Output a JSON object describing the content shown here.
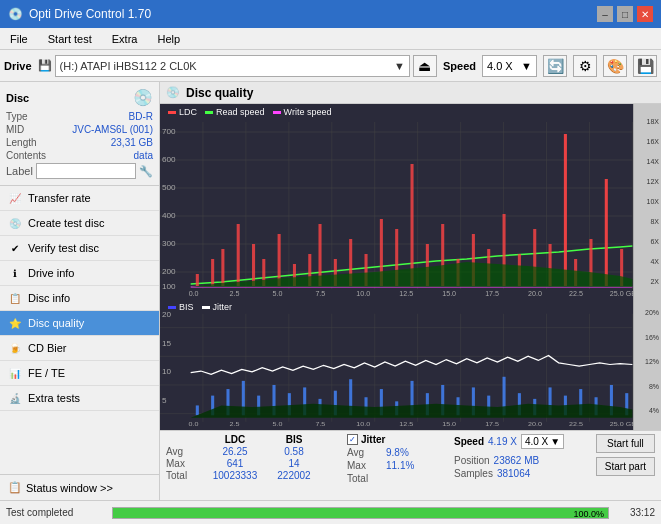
{
  "app": {
    "title": "Opti Drive Control 1.70",
    "icon": "💿"
  },
  "titlebar": {
    "title": "Opti Drive Control 1.70",
    "minimize_label": "–",
    "maximize_label": "□",
    "close_label": "✕"
  },
  "menubar": {
    "items": [
      "File",
      "Start test",
      "Extra",
      "Help"
    ]
  },
  "drivebar": {
    "label": "Drive",
    "drive_value": "(H:) ATAPI iHBS112 2 CL0K",
    "speed_label": "Speed",
    "speed_value": "4.0 X"
  },
  "disc": {
    "title": "Disc",
    "type_label": "Type",
    "type_value": "BD-R",
    "mid_label": "MID",
    "mid_value": "JVC-AMS6L (001)",
    "length_label": "Length",
    "length_value": "23,31 GB",
    "contents_label": "Contents",
    "contents_value": "data",
    "label_label": "Label",
    "label_placeholder": ""
  },
  "nav": {
    "items": [
      {
        "id": "transfer-rate",
        "label": "Transfer rate",
        "icon": "📈"
      },
      {
        "id": "create-test-disc",
        "label": "Create test disc",
        "icon": "💿"
      },
      {
        "id": "verify-test-disc",
        "label": "Verify test disc",
        "icon": "✔"
      },
      {
        "id": "drive-info",
        "label": "Drive info",
        "icon": "ℹ"
      },
      {
        "id": "disc-info",
        "label": "Disc info",
        "icon": "📋"
      },
      {
        "id": "disc-quality",
        "label": "Disc quality",
        "icon": "⭐",
        "active": true
      },
      {
        "id": "cd-bier",
        "label": "CD Bier",
        "icon": "🍺"
      },
      {
        "id": "fe-te",
        "label": "FE / TE",
        "icon": "📊"
      },
      {
        "id": "extra-tests",
        "label": "Extra tests",
        "icon": "🔬"
      }
    ]
  },
  "status_window": {
    "label": "Status window >> "
  },
  "content": {
    "title": "Disc quality",
    "icon": "💿",
    "chart_top": {
      "legend": [
        {
          "label": "LDC",
          "color": "#ff4444"
        },
        {
          "label": "Read speed",
          "color": "#44ff44"
        },
        {
          "label": "Write speed",
          "color": "#ff44ff"
        }
      ],
      "y_axis_labels": [
        "700",
        "600",
        "500",
        "400",
        "300",
        "200",
        "100"
      ],
      "y_axis_right_labels": [
        "18X",
        "16X",
        "14X",
        "12X",
        "10X",
        "8X",
        "6X",
        "4X",
        "2X"
      ],
      "x_axis_labels": [
        "0.0",
        "2.5",
        "5.0",
        "7.5",
        "10.0",
        "12.5",
        "15.0",
        "17.5",
        "20.0",
        "22.5",
        "25.0 GB"
      ]
    },
    "chart_bottom": {
      "legend": [
        {
          "label": "BIS",
          "color": "#4444ff"
        },
        {
          "label": "Jitter",
          "color": "#ffffff"
        }
      ],
      "y_axis_labels": [
        "20",
        "15",
        "10",
        "5"
      ],
      "y_axis_right_labels": [
        "20%",
        "16%",
        "12%",
        "8%",
        "4%"
      ],
      "x_axis_labels": [
        "0.0",
        "2.5",
        "5.0",
        "7.5",
        "10.0",
        "12.5",
        "15.0",
        "17.5",
        "20.0",
        "22.5",
        "25.0 GB"
      ]
    }
  },
  "stats": {
    "ldc_label": "LDC",
    "bis_label": "BIS",
    "jitter_label": "Jitter",
    "jitter_checked": true,
    "speed_label": "Speed",
    "speed_value": "4.19 X",
    "speed_dropdown": "4.0 X",
    "position_label": "Position",
    "position_value": "23862 MB",
    "samples_label": "Samples",
    "samples_value": "381064",
    "rows": [
      {
        "label": "Avg",
        "ldc": "26.25",
        "bis": "0.58",
        "jitter": "9.8%"
      },
      {
        "label": "Max",
        "ldc": "641",
        "bis": "14",
        "jitter": "11.1%"
      },
      {
        "label": "Total",
        "ldc": "10023333",
        "bis": "222002",
        "jitter": ""
      }
    ],
    "start_full_label": "Start full",
    "start_part_label": "Start part"
  },
  "bottom_status": {
    "text": "Test completed",
    "progress": 100,
    "progress_label": "100.0%",
    "time": "33:12"
  }
}
